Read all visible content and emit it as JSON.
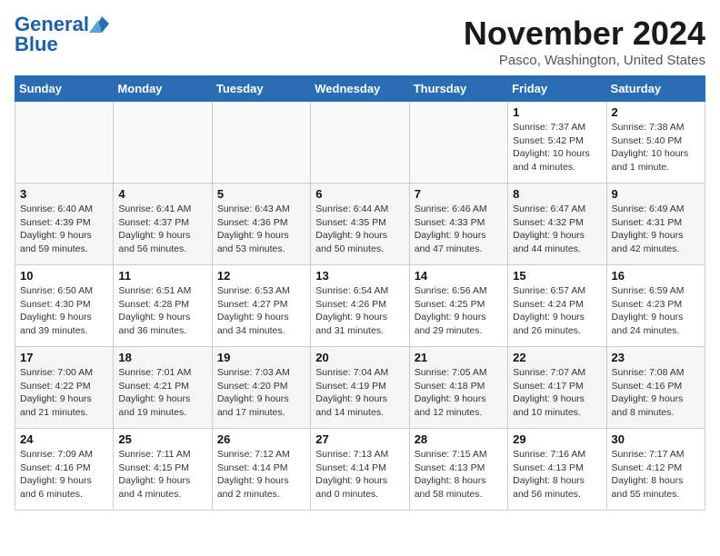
{
  "header": {
    "logo_line1": "General",
    "logo_line2": "Blue",
    "month": "November 2024",
    "location": "Pasco, Washington, United States"
  },
  "days_of_week": [
    "Sunday",
    "Monday",
    "Tuesday",
    "Wednesday",
    "Thursday",
    "Friday",
    "Saturday"
  ],
  "weeks": [
    [
      {
        "day": "",
        "info": ""
      },
      {
        "day": "",
        "info": ""
      },
      {
        "day": "",
        "info": ""
      },
      {
        "day": "",
        "info": ""
      },
      {
        "day": "",
        "info": ""
      },
      {
        "day": "1",
        "info": "Sunrise: 7:37 AM\nSunset: 5:42 PM\nDaylight: 10 hours\nand 4 minutes."
      },
      {
        "day": "2",
        "info": "Sunrise: 7:38 AM\nSunset: 5:40 PM\nDaylight: 10 hours\nand 1 minute."
      }
    ],
    [
      {
        "day": "3",
        "info": "Sunrise: 6:40 AM\nSunset: 4:39 PM\nDaylight: 9 hours\nand 59 minutes."
      },
      {
        "day": "4",
        "info": "Sunrise: 6:41 AM\nSunset: 4:37 PM\nDaylight: 9 hours\nand 56 minutes."
      },
      {
        "day": "5",
        "info": "Sunrise: 6:43 AM\nSunset: 4:36 PM\nDaylight: 9 hours\nand 53 minutes."
      },
      {
        "day": "6",
        "info": "Sunrise: 6:44 AM\nSunset: 4:35 PM\nDaylight: 9 hours\nand 50 minutes."
      },
      {
        "day": "7",
        "info": "Sunrise: 6:46 AM\nSunset: 4:33 PM\nDaylight: 9 hours\nand 47 minutes."
      },
      {
        "day": "8",
        "info": "Sunrise: 6:47 AM\nSunset: 4:32 PM\nDaylight: 9 hours\nand 44 minutes."
      },
      {
        "day": "9",
        "info": "Sunrise: 6:49 AM\nSunset: 4:31 PM\nDaylight: 9 hours\nand 42 minutes."
      }
    ],
    [
      {
        "day": "10",
        "info": "Sunrise: 6:50 AM\nSunset: 4:30 PM\nDaylight: 9 hours\nand 39 minutes."
      },
      {
        "day": "11",
        "info": "Sunrise: 6:51 AM\nSunset: 4:28 PM\nDaylight: 9 hours\nand 36 minutes."
      },
      {
        "day": "12",
        "info": "Sunrise: 6:53 AM\nSunset: 4:27 PM\nDaylight: 9 hours\nand 34 minutes."
      },
      {
        "day": "13",
        "info": "Sunrise: 6:54 AM\nSunset: 4:26 PM\nDaylight: 9 hours\nand 31 minutes."
      },
      {
        "day": "14",
        "info": "Sunrise: 6:56 AM\nSunset: 4:25 PM\nDaylight: 9 hours\nand 29 minutes."
      },
      {
        "day": "15",
        "info": "Sunrise: 6:57 AM\nSunset: 4:24 PM\nDaylight: 9 hours\nand 26 minutes."
      },
      {
        "day": "16",
        "info": "Sunrise: 6:59 AM\nSunset: 4:23 PM\nDaylight: 9 hours\nand 24 minutes."
      }
    ],
    [
      {
        "day": "17",
        "info": "Sunrise: 7:00 AM\nSunset: 4:22 PM\nDaylight: 9 hours\nand 21 minutes."
      },
      {
        "day": "18",
        "info": "Sunrise: 7:01 AM\nSunset: 4:21 PM\nDaylight: 9 hours\nand 19 minutes."
      },
      {
        "day": "19",
        "info": "Sunrise: 7:03 AM\nSunset: 4:20 PM\nDaylight: 9 hours\nand 17 minutes."
      },
      {
        "day": "20",
        "info": "Sunrise: 7:04 AM\nSunset: 4:19 PM\nDaylight: 9 hours\nand 14 minutes."
      },
      {
        "day": "21",
        "info": "Sunrise: 7:05 AM\nSunset: 4:18 PM\nDaylight: 9 hours\nand 12 minutes."
      },
      {
        "day": "22",
        "info": "Sunrise: 7:07 AM\nSunset: 4:17 PM\nDaylight: 9 hours\nand 10 minutes."
      },
      {
        "day": "23",
        "info": "Sunrise: 7:08 AM\nSunset: 4:16 PM\nDaylight: 9 hours\nand 8 minutes."
      }
    ],
    [
      {
        "day": "24",
        "info": "Sunrise: 7:09 AM\nSunset: 4:16 PM\nDaylight: 9 hours\nand 6 minutes."
      },
      {
        "day": "25",
        "info": "Sunrise: 7:11 AM\nSunset: 4:15 PM\nDaylight: 9 hours\nand 4 minutes."
      },
      {
        "day": "26",
        "info": "Sunrise: 7:12 AM\nSunset: 4:14 PM\nDaylight: 9 hours\nand 2 minutes."
      },
      {
        "day": "27",
        "info": "Sunrise: 7:13 AM\nSunset: 4:14 PM\nDaylight: 9 hours\nand 0 minutes."
      },
      {
        "day": "28",
        "info": "Sunrise: 7:15 AM\nSunset: 4:13 PM\nDaylight: 8 hours\nand 58 minutes."
      },
      {
        "day": "29",
        "info": "Sunrise: 7:16 AM\nSunset: 4:13 PM\nDaylight: 8 hours\nand 56 minutes."
      },
      {
        "day": "30",
        "info": "Sunrise: 7:17 AM\nSunset: 4:12 PM\nDaylight: 8 hours\nand 55 minutes."
      }
    ]
  ]
}
